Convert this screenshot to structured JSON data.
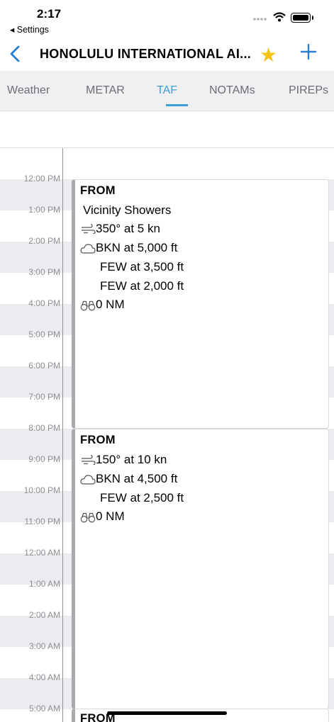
{
  "status_bar": {
    "time": "2:17",
    "back_app": "◂ Settings"
  },
  "nav": {
    "title": "HONOLULU INTERNATIONAL AI...",
    "star_icon": "star-icon",
    "add_icon": "plus-icon"
  },
  "tabs": [
    {
      "label": "Weather",
      "active": false
    },
    {
      "label": "METAR",
      "active": false
    },
    {
      "label": "TAF",
      "active": true
    },
    {
      "label": "NOTAMs",
      "active": false
    },
    {
      "label": "PIREPs",
      "active": false
    }
  ],
  "hours": [
    "12:00 PM",
    "1:00 PM",
    "2:00 PM",
    "3:00 PM",
    "4:00 PM",
    "5:00 PM",
    "6:00 PM",
    "7:00 PM",
    "8:00 PM",
    "9:00 PM",
    "10:00 PM",
    "11:00 PM",
    "12:00 AM",
    "1:00 AM",
    "2:00 AM",
    "3:00 AM",
    "4:00 AM",
    "5:00 AM"
  ],
  "forecasts": [
    {
      "header": "FROM",
      "weather": "Vicinity Showers",
      "wind": "350° at 5 kn",
      "clouds": [
        "BKN at 5,000 ft",
        "FEW at 3,500 ft",
        "FEW at 2,000 ft"
      ],
      "visibility": "0 NM"
    },
    {
      "header": "FROM",
      "wind": "150° at 10 kn",
      "clouds": [
        "BKN at 4,500 ft",
        "FEW at 2,500 ft"
      ],
      "visibility": "0 NM"
    },
    {
      "header": "FROM"
    }
  ],
  "colors": {
    "accent": "#3aa0d8",
    "star": "#f6c417",
    "back_chevron": "#2a7fd4"
  }
}
